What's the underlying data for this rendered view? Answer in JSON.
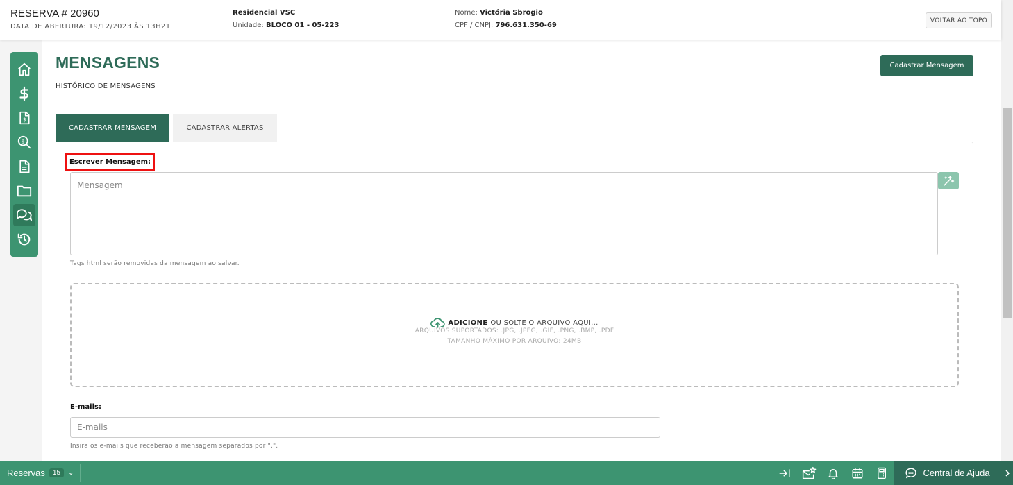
{
  "header": {
    "reservation": "RESERVA # 20960",
    "opening_date": "DATA DE ABERTURA: 19/12/2023 ÀS 13H21",
    "project": "Residencial VSC",
    "unit_label": "Unidade:",
    "unit_value": "BLOCO 01 - 05-223",
    "name_label": "Nome:",
    "name_value": "Victória Sbrogio",
    "cpf_label": "CPF / CNPJ:",
    "cpf_value": "796.631.350-69",
    "back_to_top": "VOLTAR AO TOPO"
  },
  "sidebar": {
    "items": [
      {
        "name": "home-icon"
      },
      {
        "name": "dollar-icon"
      },
      {
        "name": "invoice-icon"
      },
      {
        "name": "search-money-icon"
      },
      {
        "name": "document-icon"
      },
      {
        "name": "folder-icon"
      },
      {
        "name": "messages-icon",
        "active": true
      },
      {
        "name": "history-icon"
      }
    ]
  },
  "page": {
    "title": "MENSAGENS",
    "subtitle": "HISTÓRICO DE MENSAGENS",
    "register_button": "Cadastrar Mensagem"
  },
  "tabs": [
    {
      "label": "CADASTRAR MENSAGEM",
      "active": true
    },
    {
      "label": "CADASTRAR ALERTAS",
      "active": false
    }
  ],
  "form": {
    "message_label": "Escrever Mensagem:",
    "message_placeholder": "Mensagem",
    "message_hint": "Tags html serão removidas da mensagem ao salvar.",
    "upload_add": "ADICIONE",
    "upload_rest": "OU SOLTE O ARQUIVO AQUI...",
    "upload_formats": "ARQUIVOS SUPORTADOS: .JPG, .JPEG, .GIF, .PNG, .BMP, .PDF",
    "upload_max": "TAMANHO MÁXIMO POR ARQUIVO: 24MB",
    "emails_label": "E-mails:",
    "emails_placeholder": "E-mails",
    "emails_hint": "Insira os e-mails que receberão a mensagem separados por \",\"."
  },
  "footer": {
    "reservas_label": "Reservas",
    "reservas_count": "15",
    "help_label": "Central de Ajuda"
  },
  "colors": {
    "primary_dark": "#2e6b58",
    "primary": "#3d9471",
    "highlight": "#e11111"
  }
}
